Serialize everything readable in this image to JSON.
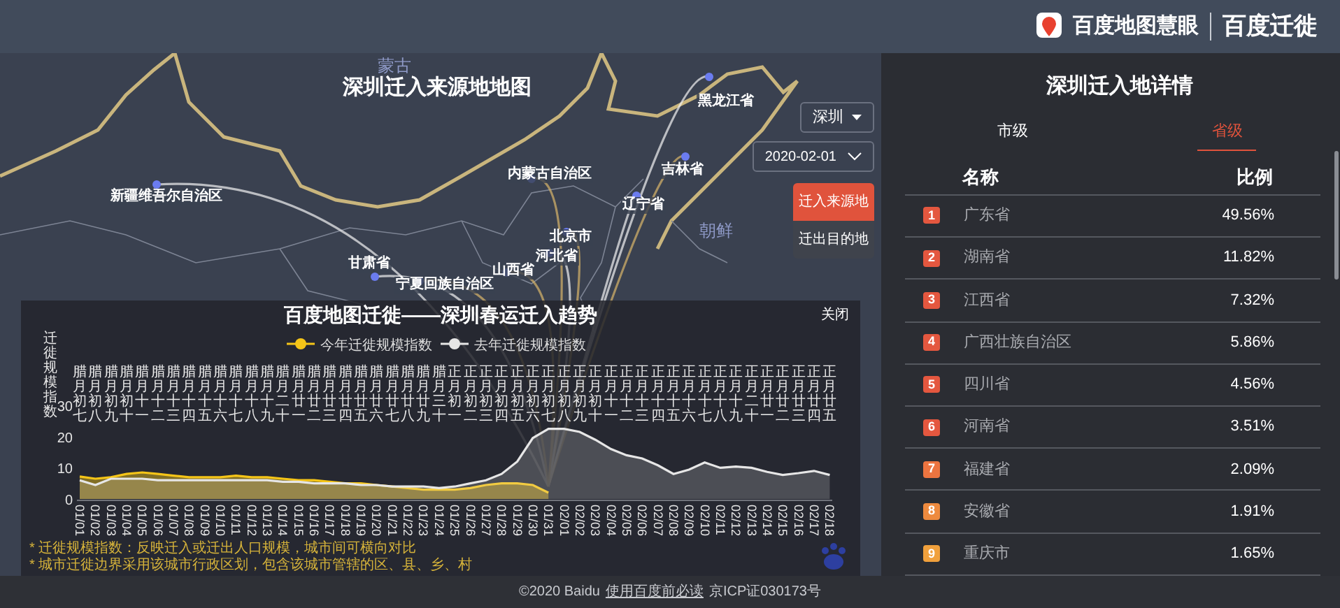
{
  "header": {
    "logo_text": "百度地图慧眼",
    "product": "百度迁徙"
  },
  "map": {
    "title": "深圳迁入来源地地图",
    "city_select": {
      "value": "深圳"
    },
    "date_select": {
      "value": "2020-02-01"
    },
    "modes": [
      {
        "label": "迁入来源地",
        "selected": true
      },
      {
        "label": "迁出目的地",
        "selected": false
      }
    ],
    "place_labels": [
      {
        "kind": "country",
        "text": "蒙古"
      },
      {
        "kind": "province",
        "text": "新疆维吾尔自治区"
      },
      {
        "kind": "province",
        "text": "内蒙古自治区"
      },
      {
        "kind": "province",
        "text": "黑龙江省"
      },
      {
        "kind": "province",
        "text": "吉林省"
      },
      {
        "kind": "province",
        "text": "辽宁省"
      },
      {
        "kind": "country",
        "text": "朝鲜"
      },
      {
        "kind": "province",
        "text": "北京市"
      },
      {
        "kind": "province",
        "text": "河北省"
      },
      {
        "kind": "province",
        "text": "山西省"
      },
      {
        "kind": "province",
        "text": "甘肃省"
      },
      {
        "kind": "province",
        "text": "宁夏回族自治区"
      }
    ]
  },
  "trend_panel": {
    "title": "百度地图迁徙——深圳春运迁入趋势",
    "close": "关闭",
    "lunar_labels": [
      "腊月初七",
      "腊月初八",
      "腊月初九",
      "腊月初十",
      "腊月十一",
      "腊月十二",
      "腊月十三",
      "腊月十四",
      "腊月十五",
      "腊月十六",
      "腊月十七",
      "腊月十八",
      "腊月十九",
      "腊月二十",
      "腊月廿一",
      "腊月廿二",
      "腊月廿三",
      "腊月廿四",
      "腊月廿五",
      "腊月廿六",
      "腊月廿七",
      "腊月廿八",
      "腊月廿九",
      "腊月三十",
      "正月初一",
      "正月初二",
      "正月初三",
      "正月初四",
      "正月初五",
      "正月初六",
      "正月初七",
      "正月初八",
      "正月初九",
      "正月初十",
      "正月十一",
      "正月十二",
      "正月十三",
      "正月十四",
      "正月十五",
      "正月十六",
      "正月十七",
      "正月十八",
      "正月十九",
      "正月二十",
      "正月廿一",
      "正月廿二",
      "正月廿三",
      "正月廿四",
      "正月廿五"
    ],
    "notes": [
      "* 迁徙规模指数：反映迁入或迁出人口规模，城市间可横向对比",
      "* 城市迁徙边界采用该城市行政区划，包含该城市管辖的区、县、乡、村"
    ],
    "chart_data": {
      "type": "area",
      "legend": true,
      "ylabel": "迁徙规模指数",
      "ylim": [
        0,
        30
      ],
      "yticks": [
        0,
        10,
        20,
        30
      ],
      "categories": [
        "01/01",
        "01/02",
        "01/03",
        "01/04",
        "01/05",
        "01/06",
        "01/07",
        "01/08",
        "01/09",
        "01/10",
        "01/11",
        "01/12",
        "01/13",
        "01/14",
        "01/15",
        "01/16",
        "01/17",
        "01/18",
        "01/19",
        "01/20",
        "01/21",
        "01/22",
        "01/23",
        "01/24",
        "01/25",
        "01/26",
        "01/27",
        "01/28",
        "01/29",
        "01/30",
        "01/31",
        "02/01",
        "02/02",
        "02/03",
        "02/04",
        "02/05",
        "02/06",
        "02/07",
        "02/08",
        "02/09",
        "02/10",
        "02/11",
        "02/12",
        "02/13",
        "02/14",
        "02/15",
        "02/16",
        "02/17",
        "02/18"
      ],
      "series": [
        {
          "name": "今年迁徙规模指数",
          "color": "#f5c518",
          "values": [
            7.2,
            6.5,
            7,
            8,
            8.5,
            8,
            7.5,
            7,
            7,
            7,
            7.5,
            7,
            7,
            6.5,
            6,
            6,
            5.5,
            5,
            5,
            4.5,
            4,
            3.5,
            3,
            3,
            3,
            3.5,
            4.5,
            5,
            5,
            4.5,
            2,
            null,
            null,
            null,
            null,
            null,
            null,
            null,
            null,
            null,
            null,
            null,
            null,
            null,
            null,
            null,
            null,
            null,
            null
          ]
        },
        {
          "name": "去年迁徙规模指数",
          "color": "#e6e6e6",
          "values": [
            6,
            4.5,
            6.5,
            6.5,
            6.5,
            6,
            6,
            6,
            6,
            6,
            6,
            6,
            6,
            5.5,
            5.5,
            5,
            5,
            5,
            4.5,
            4.5,
            4,
            4,
            4,
            3.5,
            4,
            5,
            6,
            8,
            12,
            19.5,
            22.5,
            22.5,
            21.5,
            19,
            16,
            14,
            13,
            10.8,
            8,
            9.4,
            11.7,
            10,
            10.4,
            10,
            8.7,
            7.7,
            8.3,
            9,
            7.7
          ]
        }
      ]
    }
  },
  "detail": {
    "title": "深圳迁入地详情",
    "tabs": [
      {
        "label": "市级",
        "selected": false
      },
      {
        "label": "省级",
        "selected": true
      }
    ],
    "columns": [
      "名称",
      "比例"
    ],
    "rows": [
      {
        "rank": "1",
        "name": "广东省",
        "share": "49.56%",
        "color": "#e4573f"
      },
      {
        "rank": "2",
        "name": "湖南省",
        "share": "11.82%",
        "color": "#e4573f"
      },
      {
        "rank": "3",
        "name": "江西省",
        "share": "7.32%",
        "color": "#e4573f"
      },
      {
        "rank": "4",
        "name": "广西壮族自治区",
        "share": "5.86%",
        "color": "#e4573f"
      },
      {
        "rank": "5",
        "name": "四川省",
        "share": "4.56%",
        "color": "#e4573f"
      },
      {
        "rank": "6",
        "name": "河南省",
        "share": "3.51%",
        "color": "#e4573f"
      },
      {
        "rank": "7",
        "name": "福建省",
        "share": "2.09%",
        "color": "#ec7440"
      },
      {
        "rank": "8",
        "name": "安徽省",
        "share": "1.91%",
        "color": "#ee8a3e"
      },
      {
        "rank": "9",
        "name": "重庆市",
        "share": "1.65%",
        "color": "#f0a03c"
      }
    ]
  },
  "footer": {
    "copyright": "©2020 Baidu",
    "link": "使用百度前必读",
    "license": "京ICP证030173号"
  }
}
